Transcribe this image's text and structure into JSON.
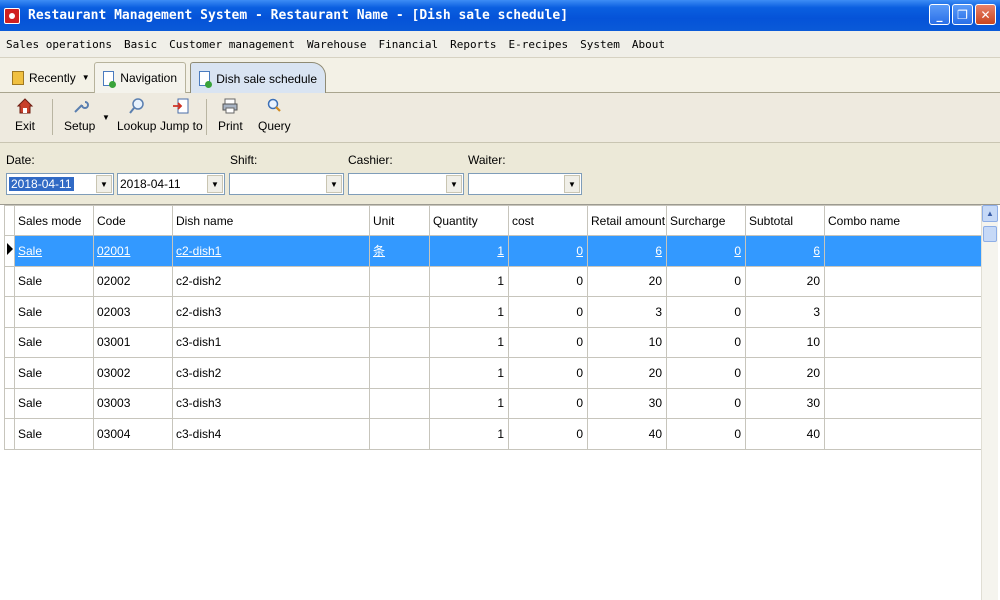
{
  "window": {
    "title": "Restaurant Management System - Restaurant Name - [Dish sale schedule]",
    "minimize": "_",
    "restore": "❐",
    "close": "✕"
  },
  "menu": [
    "Sales operations",
    "Basic",
    "Customer management",
    "Warehouse",
    "Financial",
    "Reports",
    "E-recipes",
    "System",
    "About"
  ],
  "tabs": {
    "recently": "Recently",
    "navigation": "Navigation",
    "active": "Dish sale schedule"
  },
  "toolbar": {
    "exit": "Exit",
    "setup": "Setup",
    "lookup": "Lookup",
    "jump_to": "Jump to",
    "print": "Print",
    "query": "Query"
  },
  "filters": {
    "date_label": "Date:",
    "date_from": "2018-04-11",
    "date_to": "2018-04-11",
    "shift_label": "Shift:",
    "shift_value": "",
    "cashier_label": "Cashier:",
    "cashier_value": "",
    "waiter_label": "Waiter:",
    "waiter_value": ""
  },
  "grid": {
    "columns": [
      "Sales mode",
      "Code",
      "Dish name",
      "Unit",
      "Quantity",
      "cost",
      "Retail amount",
      "Surcharge",
      "Subtotal",
      "Combo name"
    ],
    "rows": [
      {
        "mode": "Sale",
        "code": "02001",
        "name": "c2-dish1",
        "unit": "条",
        "qty": "1",
        "cost": "0",
        "retail": "6",
        "surcharge": "0",
        "subtotal": "6",
        "combo": ""
      },
      {
        "mode": "Sale",
        "code": "02002",
        "name": "c2-dish2",
        "unit": "",
        "qty": "1",
        "cost": "0",
        "retail": "20",
        "surcharge": "0",
        "subtotal": "20",
        "combo": ""
      },
      {
        "mode": "Sale",
        "code": "02003",
        "name": "c2-dish3",
        "unit": "",
        "qty": "1",
        "cost": "0",
        "retail": "3",
        "surcharge": "0",
        "subtotal": "3",
        "combo": ""
      },
      {
        "mode": "Sale",
        "code": "03001",
        "name": "c3-dish1",
        "unit": "",
        "qty": "1",
        "cost": "0",
        "retail": "10",
        "surcharge": "0",
        "subtotal": "10",
        "combo": ""
      },
      {
        "mode": "Sale",
        "code": "03002",
        "name": "c3-dish2",
        "unit": "",
        "qty": "1",
        "cost": "0",
        "retail": "20",
        "surcharge": "0",
        "subtotal": "20",
        "combo": ""
      },
      {
        "mode": "Sale",
        "code": "03003",
        "name": "c3-dish3",
        "unit": "",
        "qty": "1",
        "cost": "0",
        "retail": "30",
        "surcharge": "0",
        "subtotal": "30",
        "combo": ""
      },
      {
        "mode": "Sale",
        "code": "03004",
        "name": "c3-dish4",
        "unit": "",
        "qty": "1",
        "cost": "0",
        "retail": "40",
        "surcharge": "0",
        "subtotal": "40",
        "combo": ""
      }
    ],
    "selected_row": 0
  },
  "colors": {
    "titlebar": "#0553d8",
    "selection": "#3399ff"
  }
}
